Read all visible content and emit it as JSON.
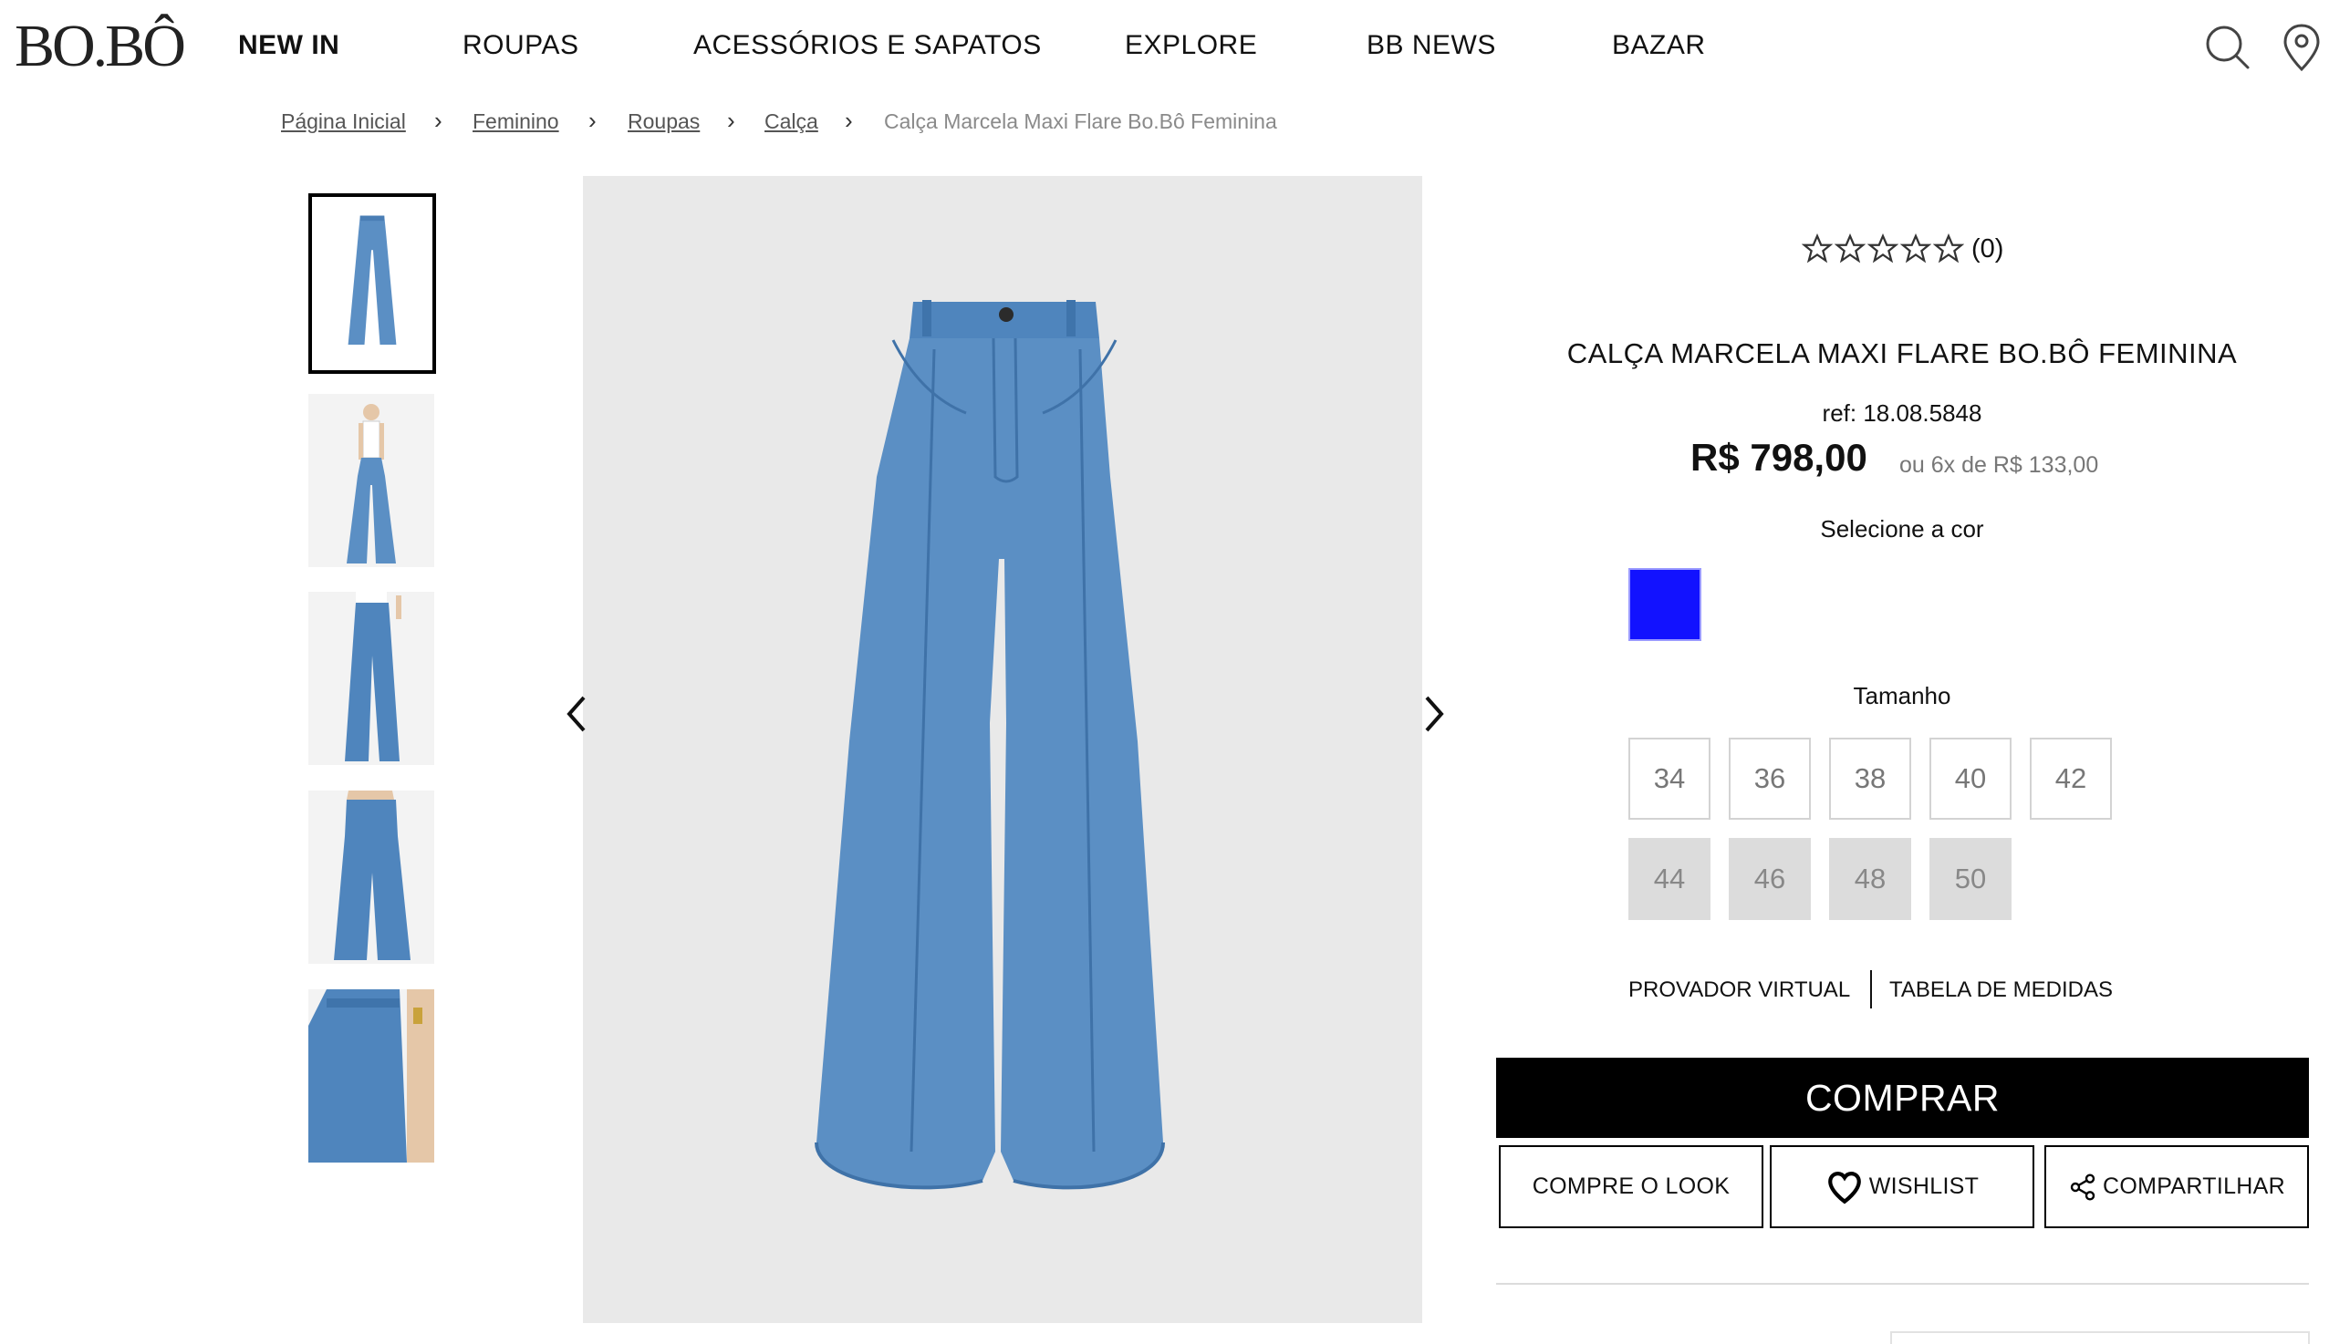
{
  "brand": {
    "logo": "BO.BÔ"
  },
  "nav": {
    "items": [
      {
        "label": "NEW IN",
        "active": true
      },
      {
        "label": "ROUPAS"
      },
      {
        "label": "ACESSÓRIOS E SAPATOS"
      },
      {
        "label": "EXPLORE"
      },
      {
        "label": "BB NEWS"
      },
      {
        "label": "BAZAR"
      }
    ],
    "icons": [
      "search-icon",
      "location-pin-icon"
    ]
  },
  "breadcrumb": {
    "items": [
      "Página Inicial",
      "Feminino",
      "Roupas",
      "Calça"
    ],
    "current": "Calça Marcela Maxi Flare Bo.Bô Feminina"
  },
  "gallery": {
    "thumbnail_count": 5,
    "selected_index": 0
  },
  "product": {
    "rating_stars": 0,
    "rating_count": "(0)",
    "title": "CALÇA MARCELA MAXI FLARE BO.BÔ FEMININA",
    "ref": "ref: 18.08.5848",
    "price": "R$ 798,00",
    "installments": "ou 6x de R$ 133,00",
    "color_label": "Selecione a cor",
    "color_swatch": "#1212ff",
    "size_label": "Tamanho",
    "sizes_available": [
      "34",
      "36",
      "38",
      "40",
      "42"
    ],
    "sizes_unavailable": [
      "44",
      "46",
      "48",
      "50"
    ],
    "virtual_fitting": "PROVADOR VIRTUAL",
    "size_chart": "TABELA DE MEDIDAS",
    "buy_label": "COMPRAR",
    "shop_look_label": "COMPRE O LOOK",
    "wishlist_label": "WISHLIST",
    "share_label": "COMPARTILHAR"
  },
  "colors": {
    "buy_button_bg": "#000000",
    "denim": "#5b8fc4",
    "image_bg": "#e9e9e9"
  }
}
